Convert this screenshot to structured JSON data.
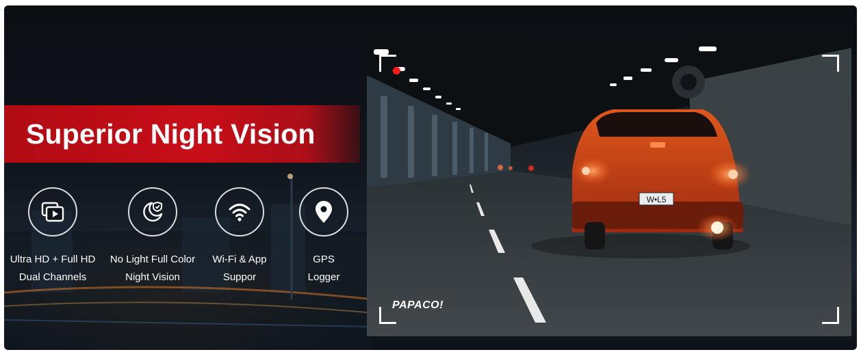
{
  "banner": {
    "title": "Superior Night Vision",
    "features": [
      {
        "icon": "dual-channel-video-icon",
        "line1": "Ultra HD + Full HD",
        "line2": "Dual Channels"
      },
      {
        "icon": "moon-night-vision-icon",
        "line1": "No Light Full Color",
        "line2": "Night Vision"
      },
      {
        "icon": "wifi-icon",
        "line1": "Wi-Fi & App",
        "line2": "Suppor"
      },
      {
        "icon": "location-pin-icon",
        "line1": "GPS",
        "line2": "Logger"
      }
    ]
  },
  "photo": {
    "watermark": "PAPACO!",
    "license_plate": "W•L5",
    "recording_indicator_color": "#ff1a1a"
  },
  "colors": {
    "accent": "#c70e18",
    "background": "#0e131a"
  }
}
